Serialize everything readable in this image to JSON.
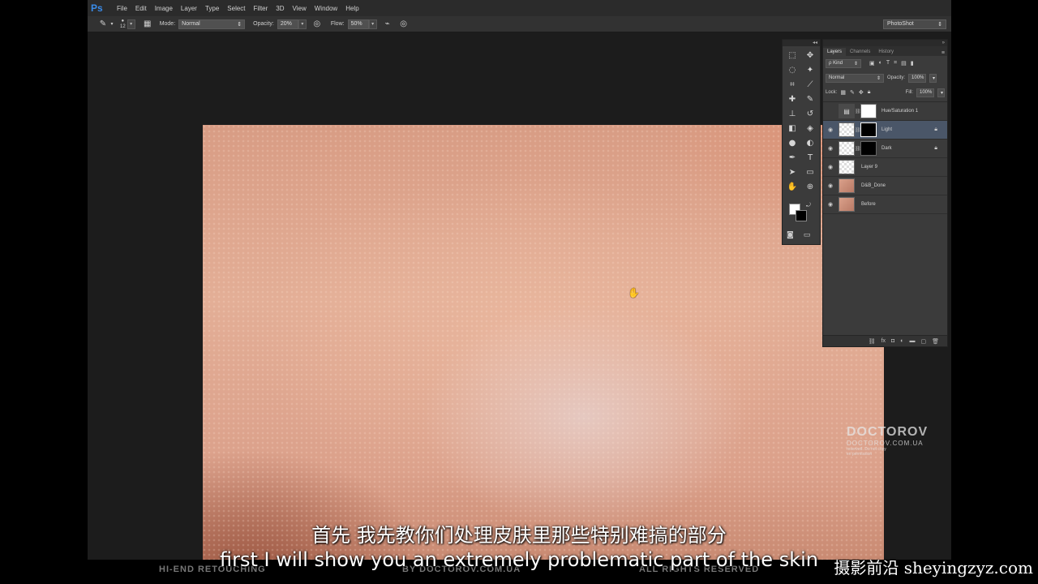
{
  "app": {
    "logo": "Ps",
    "menu": [
      "File",
      "Edit",
      "Image",
      "Layer",
      "Type",
      "Select",
      "Filter",
      "3D",
      "View",
      "Window",
      "Help"
    ],
    "workspace": "PhotoShot"
  },
  "options": {
    "brush_size": "12",
    "mode_label": "Mode:",
    "mode_value": "Normal",
    "opacity_label": "Opacity:",
    "opacity_value": "20%",
    "flow_label": "Flow:",
    "flow_value": "50%"
  },
  "layers_panel": {
    "tabs": [
      "Layers",
      "Channels",
      "History"
    ],
    "kind_label": "ρ Kind",
    "blend_mode": "Normal",
    "opacity_label": "Opacity:",
    "opacity_value": "100%",
    "lock_label": "Lock:",
    "fill_label": "Fill:",
    "fill_value": "100%",
    "layers": [
      {
        "name": "Hue/Saturation 1",
        "visible": false
      },
      {
        "name": "Light",
        "visible": true
      },
      {
        "name": "Dark",
        "visible": true
      },
      {
        "name": "Layer 9",
        "visible": true
      },
      {
        "name": "D&B_Done",
        "visible": true
      },
      {
        "name": "Before",
        "visible": true
      }
    ]
  },
  "watermark": {
    "brand": "DOCTOROV",
    "site": "DOCTOROV.COM.UA",
    "line1": "reserved. Do not copy",
    "line2": "en permission"
  },
  "subtitles": {
    "chinese": "首先 我先教你们处理皮肤里那些特别难搞的部分",
    "english": "first I will show you an extremely problematic part of the skin"
  },
  "footer": {
    "left": "HI-END RETOUCHING",
    "center": "BY DOCTOROV.COM.UA",
    "right": "ALL RIGHTS RESERVED",
    "site_watermark": "摄影前沿 sheyingzyz.com"
  }
}
